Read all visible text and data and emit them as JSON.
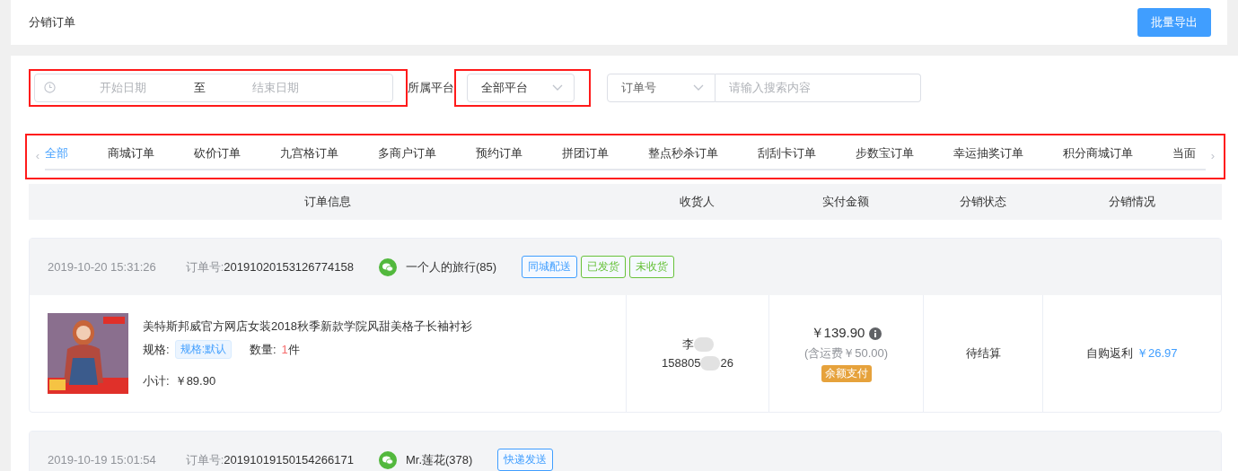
{
  "page_title": "分销订单",
  "export_button": "批量导出",
  "filters": {
    "date_range": {
      "start_placeholder": "开始日期",
      "separator": "至",
      "end_placeholder": "结束日期",
      "highlighted": true
    },
    "platform": {
      "label": "所属平台",
      "value": "全部平台",
      "highlighted": true
    },
    "search": {
      "field_type": "订单号",
      "placeholder": "请输入搜索内容",
      "highlighted": false
    }
  },
  "tabs_highlighted": true,
  "tab_scroll": {
    "left": "‹",
    "right": "›"
  },
  "tabs": [
    {
      "label": "全部",
      "selected": true
    },
    {
      "label": "商城订单",
      "selected": false
    },
    {
      "label": "砍价订单",
      "selected": false
    },
    {
      "label": "九宫格订单",
      "selected": false
    },
    {
      "label": "多商户订单",
      "selected": false
    },
    {
      "label": "预约订单",
      "selected": false
    },
    {
      "label": "拼团订单",
      "selected": false
    },
    {
      "label": "整点秒杀订单",
      "selected": false
    },
    {
      "label": "刮刮卡订单",
      "selected": false
    },
    {
      "label": "步数宝订单",
      "selected": false
    },
    {
      "label": "幸运抽奖订单",
      "selected": false
    },
    {
      "label": "积分商城订单",
      "selected": false
    },
    {
      "label": "当面",
      "selected": false
    }
  ],
  "table": {
    "columns": [
      "订单信息",
      "收货人",
      "实付金额",
      "分销状态",
      "分销情况"
    ]
  },
  "orders": [
    {
      "time": "2019-10-20 15:31:26",
      "order_no_label": "订单号:",
      "order_no": "20191020153126774158",
      "buyer": "一个人的旅行(85)",
      "tags": [
        {
          "label": "同城配送",
          "color": "#409eff"
        },
        {
          "label": "已发货",
          "color": "#67c23a"
        },
        {
          "label": "未收货",
          "color": "#67c23a"
        }
      ],
      "item": {
        "title": "美特斯邦威官方网店女装2018秋季新款学院风甜美格子长袖衬衫",
        "spec_label": "规格:",
        "spec": "规格:默认",
        "qty_label": "数量:",
        "qty": "1",
        "qty_unit": "件",
        "subtotal_label": "小计:",
        "subtotal": "￥89.90"
      },
      "receiver": {
        "name": "李",
        "phone_start": "158805",
        "phone_end": "26"
      },
      "paid": {
        "amount": "￥139.90",
        "shipping": "(含运费￥50.00)",
        "method": "余额支付"
      },
      "status": "待结算",
      "commission": {
        "label": "自购返利",
        "amount": "￥26.97"
      }
    },
    {
      "time": "2019-10-19 15:01:54",
      "order_no_label": "订单号:",
      "order_no": "20191019150154266171",
      "buyer": "Mr.莲花(378)",
      "tags": [
        {
          "label": "快递发送",
          "color": "#409eff"
        }
      ]
    }
  ]
}
